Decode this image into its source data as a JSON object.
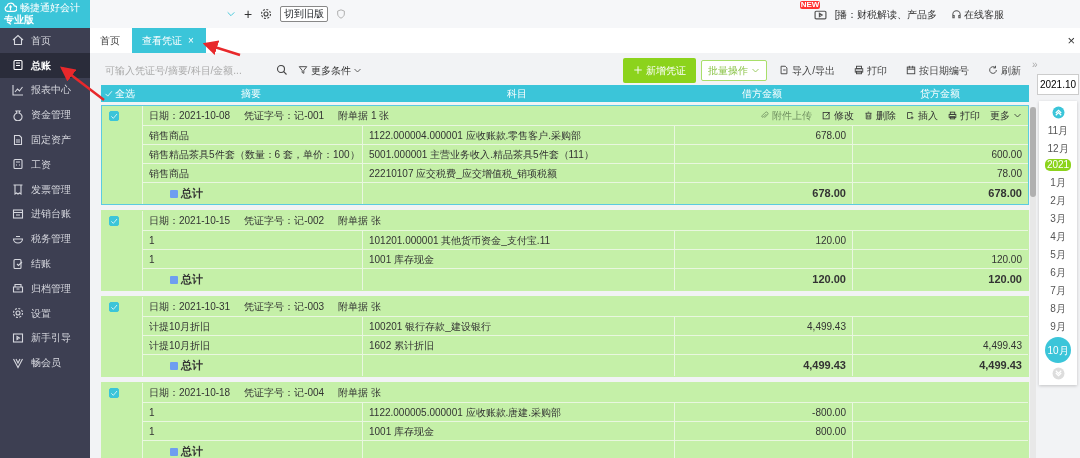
{
  "app": {
    "name": "畅捷通好会计",
    "edition": "专业版"
  },
  "sidebar": {
    "items": [
      {
        "label": "首页",
        "selected": false
      },
      {
        "label": "总账",
        "selected": true
      },
      {
        "label": "报表中心",
        "selected": false
      },
      {
        "label": "资金管理",
        "selected": false
      },
      {
        "label": "固定资产",
        "selected": false
      },
      {
        "label": "工资",
        "selected": false
      },
      {
        "label": "发票管理",
        "selected": false
      },
      {
        "label": "进销台账",
        "selected": false
      },
      {
        "label": "税务管理",
        "selected": false
      },
      {
        "label": "结账",
        "selected": false
      },
      {
        "label": "归档管理",
        "selected": false
      },
      {
        "label": "设置",
        "selected": false
      },
      {
        "label": "新手引导",
        "selected": false
      },
      {
        "label": "畅会员",
        "selected": false
      }
    ]
  },
  "topbar": {
    "add": "+",
    "switch_button": "切到旧版",
    "new_badge": "NEW",
    "broadcast": "[播：财税解读、产品多",
    "support": "在线客服"
  },
  "tabs": [
    {
      "label": "首页",
      "selected": false
    },
    {
      "label": "查看凭证",
      "selected": true,
      "close": "×"
    }
  ],
  "window_close": "×",
  "toolbar": {
    "search_placeholder": "可输入凭证号/摘要/科目/金额...",
    "more_filters": "更多条件",
    "buttons": [
      {
        "label": "新增凭证",
        "kind": "primary"
      },
      {
        "label": "批量操作",
        "kind": "dropdown"
      },
      {
        "label": "导入/导出",
        "kind": "import"
      },
      {
        "label": "打印",
        "kind": "print"
      },
      {
        "label": "按日期编号",
        "kind": "number"
      },
      {
        "label": "刷新",
        "kind": "refresh"
      }
    ]
  },
  "table": {
    "select_all": {
      "label": "全选",
      "checked": true
    },
    "columns": [
      "摘要",
      "科目",
      "借方金额",
      "贷方金额"
    ]
  },
  "vouchers": [
    {
      "selected": true,
      "checked": true,
      "date": "日期：2021-10-08",
      "number": "凭证字号：记-001",
      "attachments": "附单据 1 张",
      "actions": [
        {
          "label": "附件上传",
          "kind": "attach",
          "disabled": true
        },
        {
          "label": "修改",
          "kind": "edit",
          "disabled": false
        },
        {
          "label": "删除",
          "kind": "delete",
          "disabled": false
        },
        {
          "label": "插入",
          "kind": "insert",
          "disabled": false
        },
        {
          "label": "打印",
          "kind": "print",
          "disabled": false
        },
        {
          "label": "更多",
          "kind": "more",
          "disabled": false
        }
      ],
      "entries": [
        {
          "summary": "销售商品",
          "account": "1122.000004.000001 应收账款.零售客户.采购部",
          "debit": "678.00"
        },
        {
          "summary": "销售精品茶具5件套（数量：6 套，单价：100）",
          "account": "5001.000001 主营业务收入.精品茶具5件套（111）",
          "credit": "600.00"
        },
        {
          "summary": "销售商品",
          "account": "22210107 应交税费_应交增值税_销项税额",
          "credit": "78.00"
        }
      ],
      "total_label": "总计",
      "total_debit": "678.00",
      "total_credit": "678.00"
    },
    {
      "selected": false,
      "checked": true,
      "date": "日期：2021-10-15",
      "number": "凭证字号：记-002",
      "attachments": "附单据 张",
      "entries": [
        {
          "summary": "1",
          "account": "101201.000001 其他货币资金_支付宝.11",
          "debit": "120.00"
        },
        {
          "summary": "1",
          "account": "1001 库存现金",
          "credit": "120.00"
        }
      ],
      "total_label": "总计",
      "total_debit": "120.00",
      "total_credit": "120.00"
    },
    {
      "selected": false,
      "checked": true,
      "date": "日期：2021-10-31",
      "number": "凭证字号：记-003",
      "attachments": "附单据 张",
      "entries": [
        {
          "summary": "计提10月折旧",
          "account": "100201 银行存款_建设银行",
          "debit": "4,499.43"
        },
        {
          "summary": "计提10月折旧",
          "account": "1602 累计折旧",
          "credit": "4,499.43"
        }
      ],
      "total_label": "总计",
      "total_debit": "4,499.43",
      "total_credit": "4,499.43"
    },
    {
      "selected": false,
      "checked": true,
      "date": "日期：2021-10-18",
      "number": "凭证字号：记-004",
      "attachments": "附单据 张",
      "entries": [
        {
          "summary": "1",
          "account": "1122.000005.000001 应收账款.唐建.采购部",
          "debit": "-800.00"
        },
        {
          "summary": "1",
          "account": "1001 库存现金",
          "debit": "800.00"
        }
      ],
      "total_label": "总计"
    }
  ],
  "period_nav": {
    "expand": "»",
    "value": "2021.10",
    "months": [
      {
        "label": "11月",
        "selected": false
      },
      {
        "label": "12月",
        "selected": false
      },
      {
        "label": "1月",
        "selected": false,
        "year": "2021"
      },
      {
        "label": "2月",
        "selected": false
      },
      {
        "label": "3月",
        "selected": false
      },
      {
        "label": "4月",
        "selected": false
      },
      {
        "label": "5月",
        "selected": false
      },
      {
        "label": "6月",
        "selected": false
      },
      {
        "label": "7月",
        "selected": false
      },
      {
        "label": "8月",
        "selected": false
      },
      {
        "label": "9月",
        "selected": false
      },
      {
        "label": "10月",
        "selected": true
      }
    ]
  }
}
